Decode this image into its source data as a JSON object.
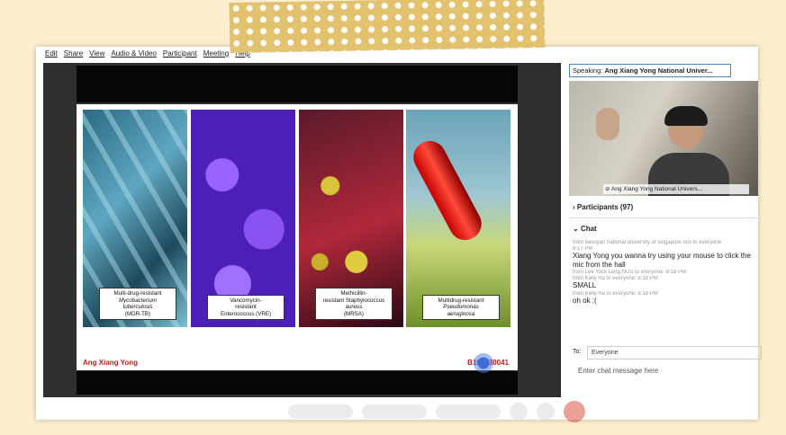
{
  "menu": [
    "Edit",
    "Share",
    "View",
    "Audio & Video",
    "Participant",
    "Meeting",
    "Help"
  ],
  "slide": {
    "panels": [
      {
        "line1": "Multi-drug-resistant",
        "line2": "Mycobacterium",
        "line3": "tuberculosis",
        "line4": "(MDR-TB)"
      },
      {
        "line1": "Vancomycin-",
        "line2": "resistant",
        "line3": "Enterococcus (VRE)",
        "line4": ""
      },
      {
        "line1": "Methicillin-",
        "line2": "resistant Staphylococcus",
        "line3": "aureus",
        "line4": "(MRSA)"
      },
      {
        "line1": "Multidrug-resistant",
        "line2": "Pseudomonas",
        "line3": "aeruginosa",
        "line4": ""
      }
    ],
    "footer_left": "Ang Xiang Yong",
    "footer_right": "B109130041"
  },
  "side": {
    "speaking_prefix": "Speaking:",
    "speaking_name": "Ang Xiang Yong National Univer...",
    "video_name": "Ang Xiang Yong National Univers...",
    "participants": "Participants (97)",
    "chat_title": "Chat",
    "messages": [
      {
        "meta": "from nasuyan national university of singapore nus to everyone",
        "time": "8:17 PM",
        "text": ""
      },
      {
        "meta": "",
        "time": "",
        "text": "Xiang Yong you wanna try using your mouse to click the mic from the hall"
      },
      {
        "meta": "from Lee Yock Leng NUS to everyone:",
        "time": "8:18 PM",
        "text": ""
      },
      {
        "meta": "from Kelly Ha to everyone:",
        "time": "8:18 PM",
        "text": "SMALL"
      },
      {
        "meta": "from Kelly Ha to everyone:",
        "time": "8:18 PM",
        "text": "oh ok :("
      }
    ],
    "to_label": "To:",
    "to_value": "Everyone",
    "entry_placeholder": "Enter chat message here"
  }
}
